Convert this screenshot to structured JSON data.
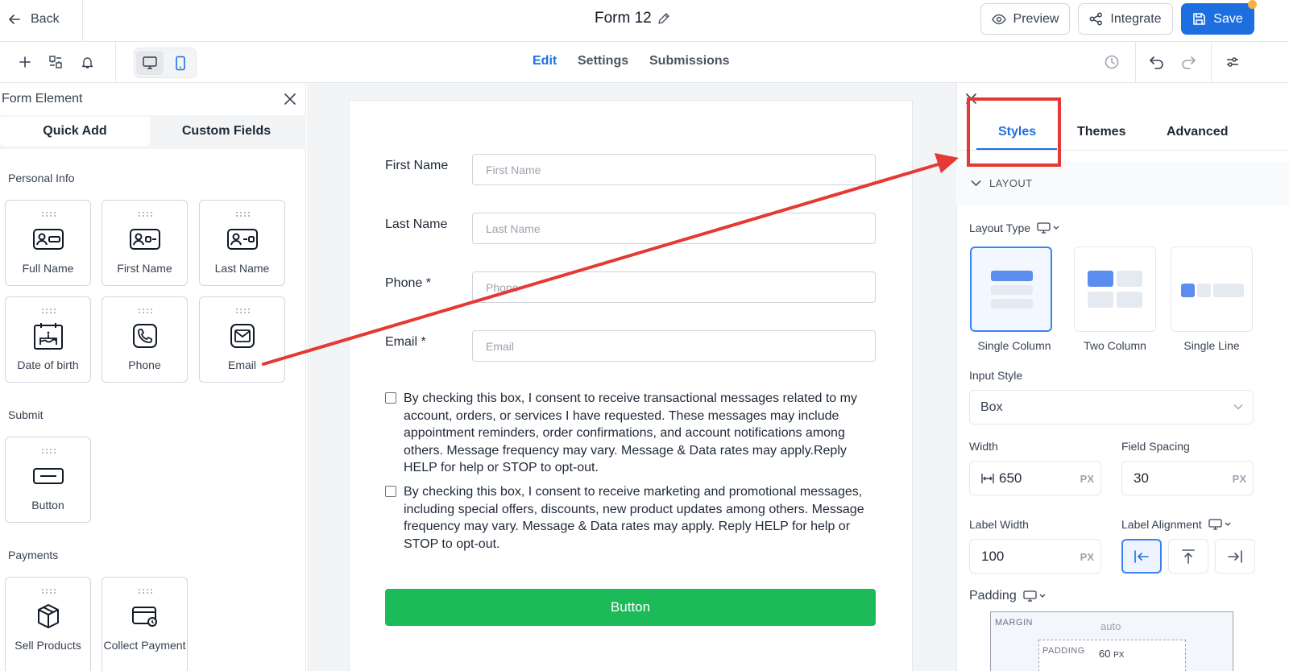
{
  "header": {
    "back_label": "Back",
    "form_title": "Form 12",
    "preview_label": "Preview",
    "integrate_label": "Integrate",
    "save_label": "Save"
  },
  "toolbar": {
    "tabs": [
      "Edit",
      "Settings",
      "Submissions"
    ],
    "active_tab": "Edit"
  },
  "left_panel": {
    "title": "Form Element",
    "tabs": [
      "Quick Add",
      "Custom Fields"
    ],
    "sections": {
      "personal_info": "Personal Info",
      "submit": "Submit",
      "payments": "Payments"
    },
    "elements": {
      "full_name": "Full Name",
      "first_name": "First Name",
      "last_name": "Last Name",
      "date_of_birth": "Date of birth",
      "phone": "Phone",
      "email": "Email",
      "button": "Button",
      "sell_products": "Sell Products",
      "collect_payment": "Collect Payment"
    }
  },
  "form": {
    "fields": [
      {
        "label": "First Name",
        "placeholder": "First Name"
      },
      {
        "label": "Last Name",
        "placeholder": "Last Name"
      },
      {
        "label": "Phone *",
        "placeholder": "Phone"
      },
      {
        "label": "Email *",
        "placeholder": "Email"
      }
    ],
    "consents": [
      "By checking this box, I consent to receive transactional messages related to my account, orders, or services I have requested. These messages may include appointment reminders, order confirmations, and account notifications among others. Message frequency may vary. Message & Data rates may apply.Reply HELP for help or STOP to opt-out.",
      "By checking this box, I consent to receive marketing and promotional messages, including special offers, discounts, new product updates among others. Message frequency may vary. Message & Data rates may apply. Reply HELP for help or STOP to opt-out."
    ],
    "button_label": "Button"
  },
  "right_panel": {
    "tabs": [
      "Styles",
      "Themes",
      "Advanced"
    ],
    "active_tab": "Styles",
    "layout_section": "LAYOUT",
    "layout_type_label": "Layout Type",
    "layout_options": [
      "Single Column",
      "Two Column",
      "Single Line"
    ],
    "selected_layout": "Single Column",
    "input_style_label": "Input Style",
    "input_style_value": "Box",
    "width_label": "Width",
    "width_value": "650",
    "field_spacing_label": "Field Spacing",
    "field_spacing_value": "30",
    "label_width_label": "Label Width",
    "label_width_value": "100",
    "label_alignment_label": "Label Alignment",
    "unit": "PX",
    "padding_label": "Padding",
    "margin_caption": "MARGIN",
    "margin_value": "auto",
    "padding_caption": "PADDING",
    "padding_value": "60",
    "padding_unit": "PX"
  },
  "colors": {
    "accent": "#1d6fe0",
    "submit_button": "#1dba5a",
    "annotation": "#e53935"
  }
}
